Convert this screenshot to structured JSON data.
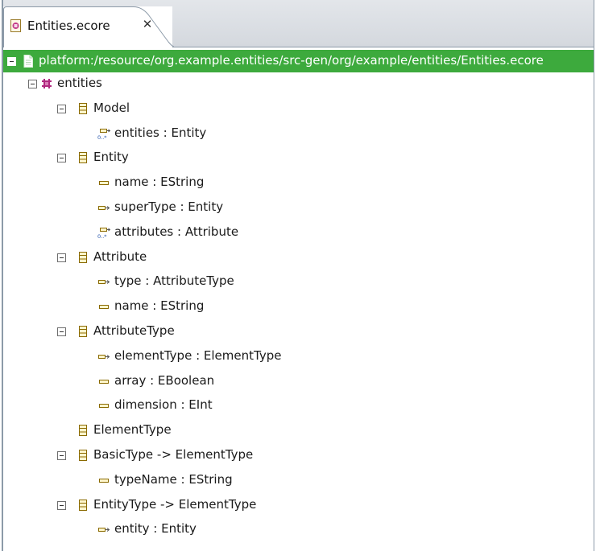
{
  "tab": {
    "title": "Entities.ecore",
    "close_glyph": "✕"
  },
  "root": {
    "label": "platform:/resource/org.example.entities/src-gen/org/example/entities/Entities.ecore"
  },
  "tree": [
    {
      "label": "entities",
      "icon": "package-icon",
      "level": 1,
      "toggle": true
    },
    {
      "label": "Model",
      "icon": "class-icon",
      "level": 2,
      "toggle": true
    },
    {
      "label": "entities : Entity",
      "icon": "reference-many-icon",
      "level": 3,
      "toggle": false
    },
    {
      "label": "Entity",
      "icon": "class-icon",
      "level": 2,
      "toggle": true
    },
    {
      "label": "name : EString",
      "icon": "attribute-icon",
      "level": 3,
      "toggle": false
    },
    {
      "label": "superType : Entity",
      "icon": "reference-icon",
      "level": 3,
      "toggle": false
    },
    {
      "label": "attributes : Attribute",
      "icon": "reference-many-icon",
      "level": 3,
      "toggle": false
    },
    {
      "label": "Attribute",
      "icon": "class-icon",
      "level": 2,
      "toggle": true
    },
    {
      "label": "type : AttributeType",
      "icon": "reference-icon",
      "level": 3,
      "toggle": false
    },
    {
      "label": "name : EString",
      "icon": "attribute-icon",
      "level": 3,
      "toggle": false
    },
    {
      "label": "AttributeType",
      "icon": "class-icon",
      "level": 2,
      "toggle": true
    },
    {
      "label": "elementType : ElementType",
      "icon": "reference-icon",
      "level": 3,
      "toggle": false
    },
    {
      "label": "array : EBoolean",
      "icon": "attribute-icon",
      "level": 3,
      "toggle": false
    },
    {
      "label": "dimension : EInt",
      "icon": "attribute-icon",
      "level": 3,
      "toggle": false
    },
    {
      "label": "ElementType",
      "icon": "class-icon",
      "level": 2,
      "toggle": false
    },
    {
      "label": "BasicType -> ElementType",
      "icon": "class-icon",
      "level": 2,
      "toggle": true
    },
    {
      "label": "typeName : EString",
      "icon": "attribute-icon",
      "level": 3,
      "toggle": false
    },
    {
      "label": "EntityType -> ElementType",
      "icon": "class-icon",
      "level": 2,
      "toggle": true
    },
    {
      "label": "entity : Entity",
      "icon": "reference-icon",
      "level": 3,
      "toggle": false
    }
  ]
}
